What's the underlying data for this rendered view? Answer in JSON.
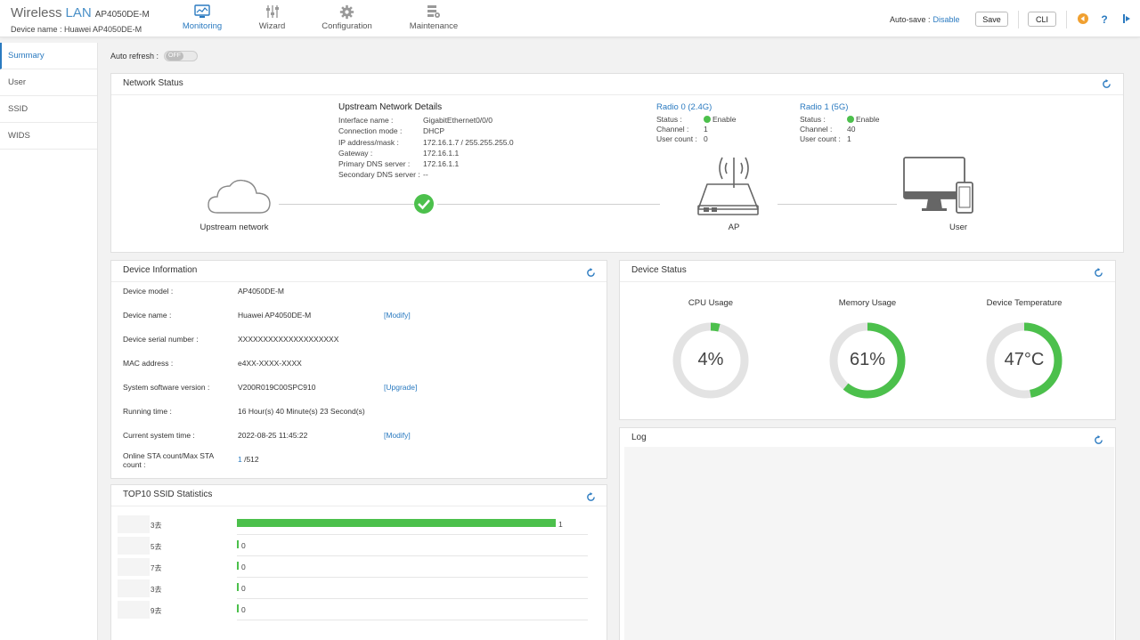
{
  "header": {
    "brand_part1": "Wireless",
    "brand_part2": "LAN",
    "model": "AP4050DE-M",
    "device_name": "Device name :  Huawei AP4050DE-M",
    "nav": [
      {
        "label": "Monitoring",
        "icon": "monitor-icon",
        "active": true
      },
      {
        "label": "Wizard",
        "icon": "sliders-icon",
        "active": false
      },
      {
        "label": "Configuration",
        "icon": "gear-icon",
        "active": false
      },
      {
        "label": "Maintenance",
        "icon": "maintenance-icon",
        "active": false
      }
    ],
    "autosave_label": "Auto-save :",
    "autosave_link": "Disable",
    "save_label": "Save",
    "cli_label": "CLI",
    "icon_colors": {
      "back": "#f0a030",
      "help": "#2a7ac0",
      "logout": "#2a7ac0"
    }
  },
  "sidebar": {
    "items": [
      {
        "label": "Summary",
        "active": true
      },
      {
        "label": "User",
        "active": false
      },
      {
        "label": "SSID",
        "active": false
      },
      {
        "label": "WIDS",
        "active": false
      }
    ]
  },
  "autorefresh": {
    "label": "Auto refresh :",
    "state": "OFF"
  },
  "network_status": {
    "title": "Network Status",
    "upstream_title": "Upstream Network Details",
    "details": [
      {
        "k": "Interface name :",
        "v": "GigabitEthernet0/0/0"
      },
      {
        "k": "Connection mode :",
        "v": "DHCP"
      },
      {
        "k": "IP address/mask :",
        "v": "172.16.1.7 / 255.255.255.0"
      },
      {
        "k": "Gateway :",
        "v": "172.16.1.1"
      },
      {
        "k": "Primary DNS server :",
        "v": "172.16.1.1"
      },
      {
        "k": "Secondary DNS server :",
        "v": "--"
      }
    ],
    "radio0": {
      "title": "Radio 0 (2.4G)",
      "status_k": "Status :",
      "status_v": "Enable",
      "channel_k": "Channel :",
      "channel_v": "1",
      "users_k": "User count :",
      "users_v": "0"
    },
    "radio1": {
      "title": "Radio 1 (5G)",
      "status_k": "Status :",
      "status_v": "Enable",
      "channel_k": "Channel :",
      "channel_v": "40",
      "users_k": "User count :",
      "users_v": "1"
    },
    "node_upstream": "Upstream network",
    "node_ap": "AP",
    "node_user": "User"
  },
  "device_info": {
    "title": "Device Information",
    "rows": [
      {
        "k": "Device model :",
        "v": "AP4050DE-M",
        "link": ""
      },
      {
        "k": "Device name :",
        "v": "Huawei AP4050DE-M",
        "link": "[Modify]"
      },
      {
        "k": "Device serial number :",
        "v": "XXXXXXXXXXXXXXXXXXXX",
        "link": ""
      },
      {
        "k": "MAC address :",
        "v": "e4XX-XXXX-XXXX",
        "link": ""
      },
      {
        "k": "System software version :",
        "v": "V200R019C00SPC910",
        "link": "[Upgrade]"
      },
      {
        "k": "Running time :",
        "v": "16 Hour(s) 40 Minute(s) 23 Second(s)",
        "link": ""
      },
      {
        "k": "Current system time :",
        "v": "2022-08-25 11:45:22",
        "link": "[Modify]"
      }
    ],
    "sta_k1": "Online STA count/Max STA",
    "sta_k2": "count :",
    "sta_online": "1",
    "sta_max": " /512"
  },
  "device_status": {
    "title": "Device Status",
    "gauges": [
      {
        "label": "CPU Usage",
        "value": 4,
        "text": "4%"
      },
      {
        "label": "Memory Usage",
        "value": 61,
        "text": "61%"
      },
      {
        "label": "Device Temperature",
        "value": 47,
        "text": "47°C"
      }
    ],
    "gauge_color": "#4cc04c",
    "track_color": "#e3e3e3"
  },
  "log": {
    "title": "Log"
  },
  "ssid_stats": {
    "title": "TOP10 SSID Statistics",
    "rows": [
      {
        "suffix": "3去",
        "value": 1
      },
      {
        "suffix": "5去",
        "value": 0
      },
      {
        "suffix": "7去",
        "value": 0
      },
      {
        "suffix": "3去",
        "value": 0
      },
      {
        "suffix": "9去",
        "value": 0
      }
    ],
    "max": 1,
    "bar_color": "#4cc04c"
  }
}
